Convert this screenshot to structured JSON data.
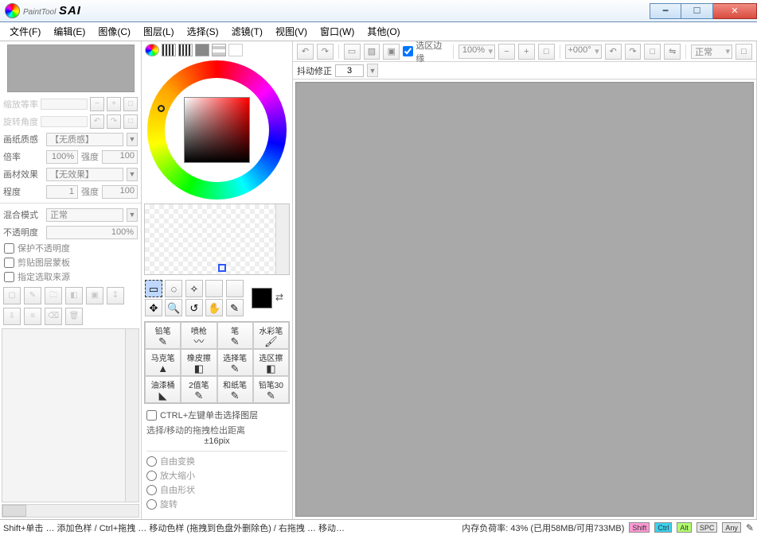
{
  "title": {
    "part1": "PaintTool",
    "part2": "SAI"
  },
  "menu": [
    "文件(F)",
    "编辑(E)",
    "图像(C)",
    "图层(L)",
    "选择(S)",
    "滤镜(T)",
    "视图(V)",
    "窗口(W)",
    "其他(O)"
  ],
  "leftPanel": {
    "paperTexture": {
      "label": "画纸质感",
      "value": "【无质感】"
    },
    "scale": {
      "label": "倍率",
      "value": "100%",
      "intensityLabel": "强度",
      "intensity": "100"
    },
    "paperEffect": {
      "label": "画材效果",
      "value": "【无效果】"
    },
    "degree": {
      "label": "程度",
      "value": "1",
      "intensityLabel": "强度",
      "intensity": "100"
    },
    "blendMode": {
      "label": "混合模式",
      "value": "正常"
    },
    "opacity": {
      "label": "不透明度",
      "value": "100%"
    },
    "protectAlpha": "保护不透明度",
    "clipMask": "剪贴图层蒙板",
    "specifySource": "指定选取来源"
  },
  "colorTools": {
    "ctrlClick": "CTRL+左键单击选择图层",
    "dragLabel": "选择/移动的拖拽检出距离",
    "dragValue": "±16pix",
    "radios": [
      "自由变换",
      "放大缩小",
      "自由形状",
      "旋转"
    ]
  },
  "brushes": [
    {
      "name": "铅笔",
      "icon": "✎"
    },
    {
      "name": "喷枪",
      "icon": "〰"
    },
    {
      "name": "笔",
      "icon": "✎"
    },
    {
      "name": "水彩笔",
      "icon": "🖌"
    },
    {
      "name": "马克笔",
      "icon": "▲"
    },
    {
      "name": "橡皮擦",
      "icon": "◧"
    },
    {
      "name": "选择笔",
      "icon": "✎"
    },
    {
      "name": "选区擦",
      "icon": "◧"
    },
    {
      "name": "油漆桶",
      "icon": "◣"
    },
    {
      "name": "2值笔",
      "icon": "✎"
    },
    {
      "name": "和纸笔",
      "icon": "✎"
    },
    {
      "name": "铅笔30",
      "icon": "✎"
    }
  ],
  "topToolbar": {
    "selEdgeLabel": "选区边缘",
    "zoom": "100%",
    "angle": "+000°",
    "blend": "正常"
  },
  "subToolbar": {
    "stabLabel": "抖动修正",
    "stabValue": "3"
  },
  "status": {
    "left": "Shift+单击 … 添加色样 / Ctrl+拖拽 … 移动色样 (拖拽到色盘外删除色) / 右拖拽 … 移动…",
    "mem": "内存负荷率: 43% (已用58MB/可用733MB)",
    "keys": [
      "Shift",
      "Ctrl",
      "Alt",
      "SPC",
      "Any"
    ]
  }
}
